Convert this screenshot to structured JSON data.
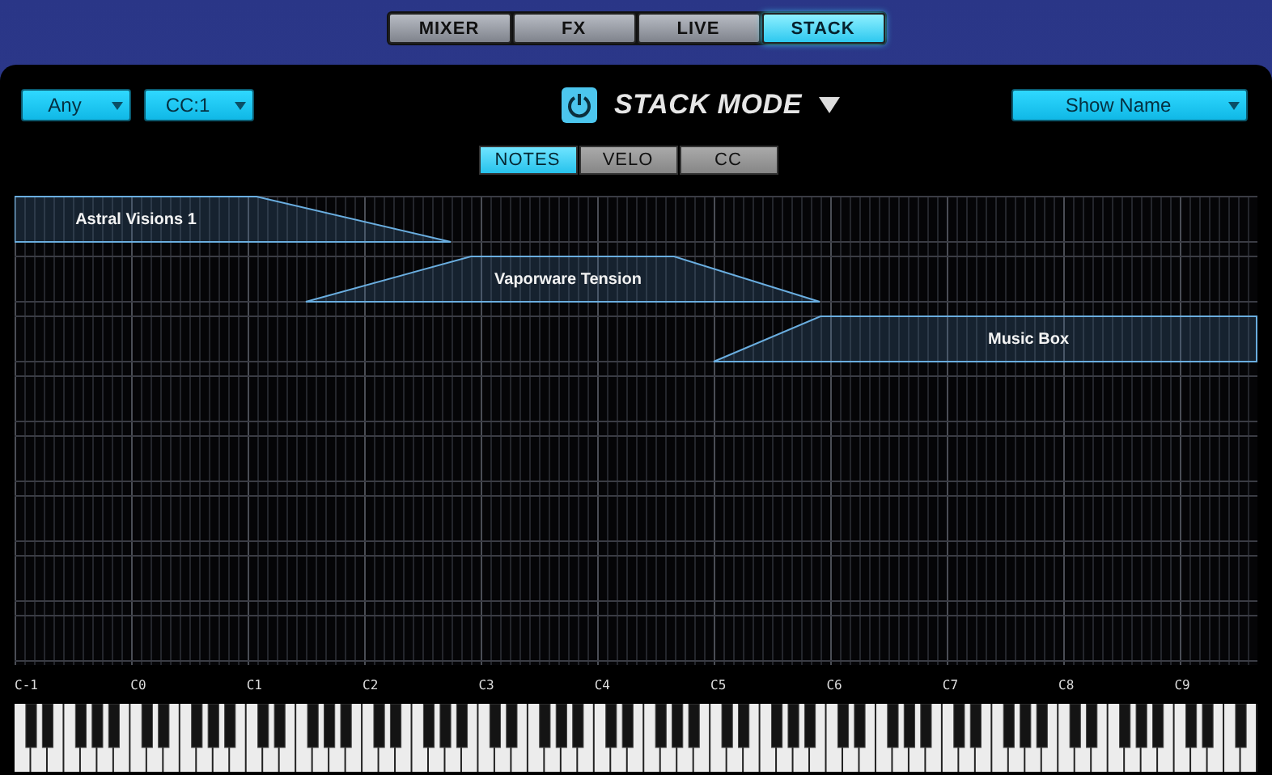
{
  "tabs": [
    {
      "label": "MIXER",
      "selected": false
    },
    {
      "label": "FX",
      "selected": false
    },
    {
      "label": "LIVE",
      "selected": false
    },
    {
      "label": "STACK",
      "selected": true
    }
  ],
  "left_selects": [
    {
      "value": "Any"
    },
    {
      "value": "CC:1"
    }
  ],
  "mode": {
    "title": "STACK MODE",
    "power_on": true
  },
  "right_select": {
    "value": "Show Name"
  },
  "view_tabs": [
    {
      "label": "NOTES",
      "selected": true
    },
    {
      "label": "VELO",
      "selected": false
    },
    {
      "label": "CC",
      "selected": false
    }
  ],
  "zones": [
    {
      "name": "Astral Visions 1"
    },
    {
      "name": "Vaporware Tension"
    },
    {
      "name": "Music Box"
    }
  ],
  "octave_labels": [
    "C-1",
    "C0",
    "C1",
    "C2",
    "C3",
    "C4",
    "C5",
    "C6",
    "C7",
    "C8",
    "C9"
  ]
}
